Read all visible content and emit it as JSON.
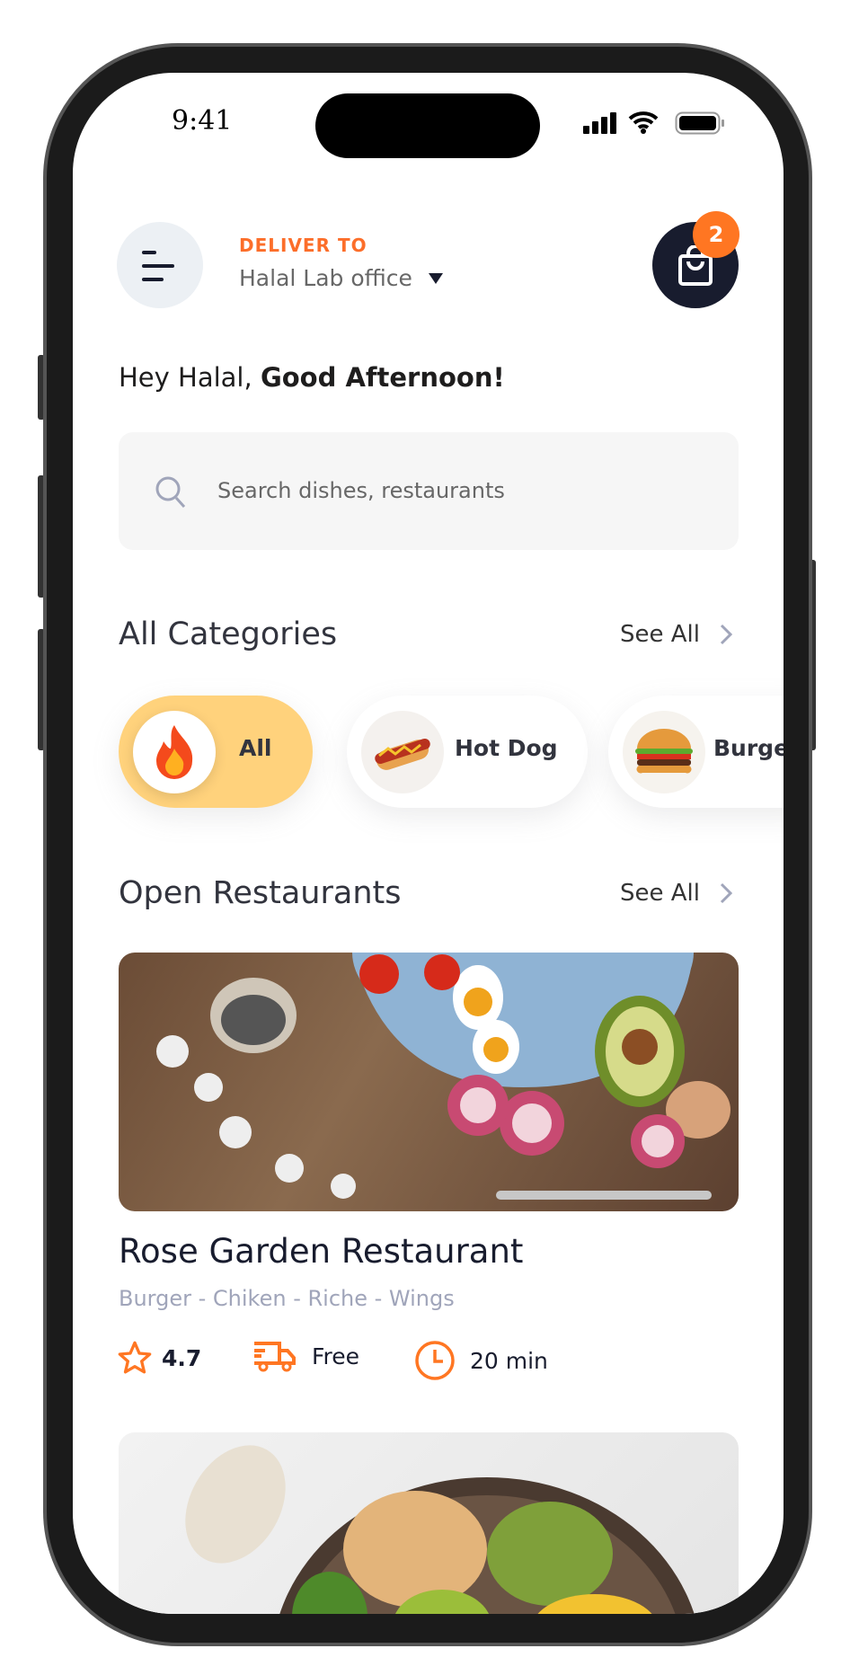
{
  "status_bar": {
    "time": "9:41"
  },
  "header": {
    "deliver_label": "DELIVER TO",
    "location": "Halal Lab office",
    "cart_count": "2"
  },
  "greeting": {
    "prefix": "Hey Halal, ",
    "emphasis": "Good Afternoon!"
  },
  "search": {
    "placeholder": "Search dishes, restaurants"
  },
  "categories": {
    "title": "All Categories",
    "see_all": "See All",
    "items": [
      {
        "label": "All",
        "icon": "fire-icon",
        "active": true
      },
      {
        "label": "Hot Dog",
        "icon": "hot-dog-icon"
      },
      {
        "label": "Burger",
        "icon": "burger-icon"
      }
    ]
  },
  "restaurants": {
    "title": "Open Restaurants",
    "see_all": "See All",
    "items": [
      {
        "name": "Rose Garden Restaurant",
        "tags": "Burger - Chiken - Riche - Wings",
        "rating": "4.7",
        "delivery": "Free",
        "time": "20 min"
      }
    ]
  },
  "colors": {
    "accent": "#FF7622",
    "active_chip": "#FFD27C",
    "dark": "#181C2E"
  }
}
